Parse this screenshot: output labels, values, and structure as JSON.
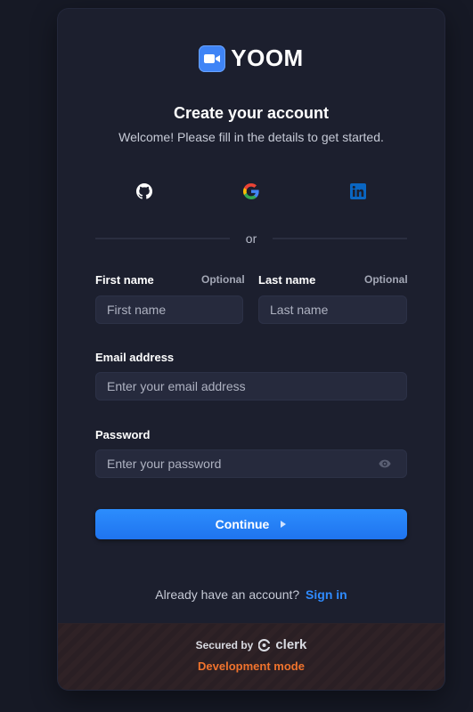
{
  "brand": {
    "name": "YOOM"
  },
  "header": {
    "title": "Create your account",
    "subtitle": "Welcome! Please fill in the details to get started."
  },
  "social": [
    {
      "name": "github-icon",
      "color": "#ffffff"
    },
    {
      "name": "google-icon",
      "color": "#4285f4"
    },
    {
      "name": "linkedin-icon",
      "color": "#0a66c2"
    }
  ],
  "divider_text": "or",
  "form": {
    "first_name": {
      "label": "First name",
      "optional": "Optional",
      "placeholder": "First name"
    },
    "last_name": {
      "label": "Last name",
      "optional": "Optional",
      "placeholder": "Last name"
    },
    "email": {
      "label": "Email address",
      "placeholder": "Enter your email address"
    },
    "password": {
      "label": "Password",
      "placeholder": "Enter your password"
    }
  },
  "continue_label": "Continue",
  "signin": {
    "prompt": "Already have an account?",
    "link": "Sign in"
  },
  "footer": {
    "secured_by": "Secured by",
    "provider": "clerk",
    "mode": "Development mode"
  },
  "colors": {
    "accent": "#2f8bff",
    "dev_mode": "#f0732d"
  }
}
